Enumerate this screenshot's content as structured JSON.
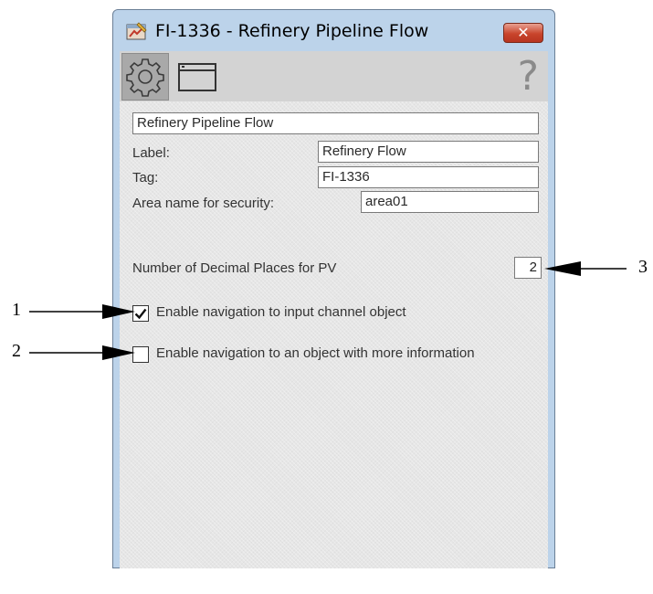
{
  "window": {
    "title": "FI-1336 - Refinery Pipeline Flow",
    "close_glyph": "✕"
  },
  "toolbar": {
    "settings_icon": "gear-icon",
    "window_icon": "window-icon",
    "help_glyph": "?"
  },
  "form": {
    "description_value": "Refinery Pipeline Flow",
    "label_label": "Label:",
    "label_value": "Refinery Flow",
    "tag_label": "Tag:",
    "tag_value": "FI-1336",
    "area_label": "Area name for security:",
    "area_value": "area01",
    "decimal_label": "Number of Decimal Places for PV",
    "decimal_value": "2",
    "nav_input_label": "Enable navigation to input channel object",
    "nav_input_checked": true,
    "nav_more_label": "Enable navigation to an object with more information",
    "nav_more_checked": false
  },
  "callouts": {
    "c1": "1",
    "c2": "2",
    "c3": "3"
  },
  "colors": {
    "frame": "#bcd3ea",
    "close": "#c9452c",
    "panel": "#e6e6e6",
    "toolbar": "#d3d3d3"
  }
}
